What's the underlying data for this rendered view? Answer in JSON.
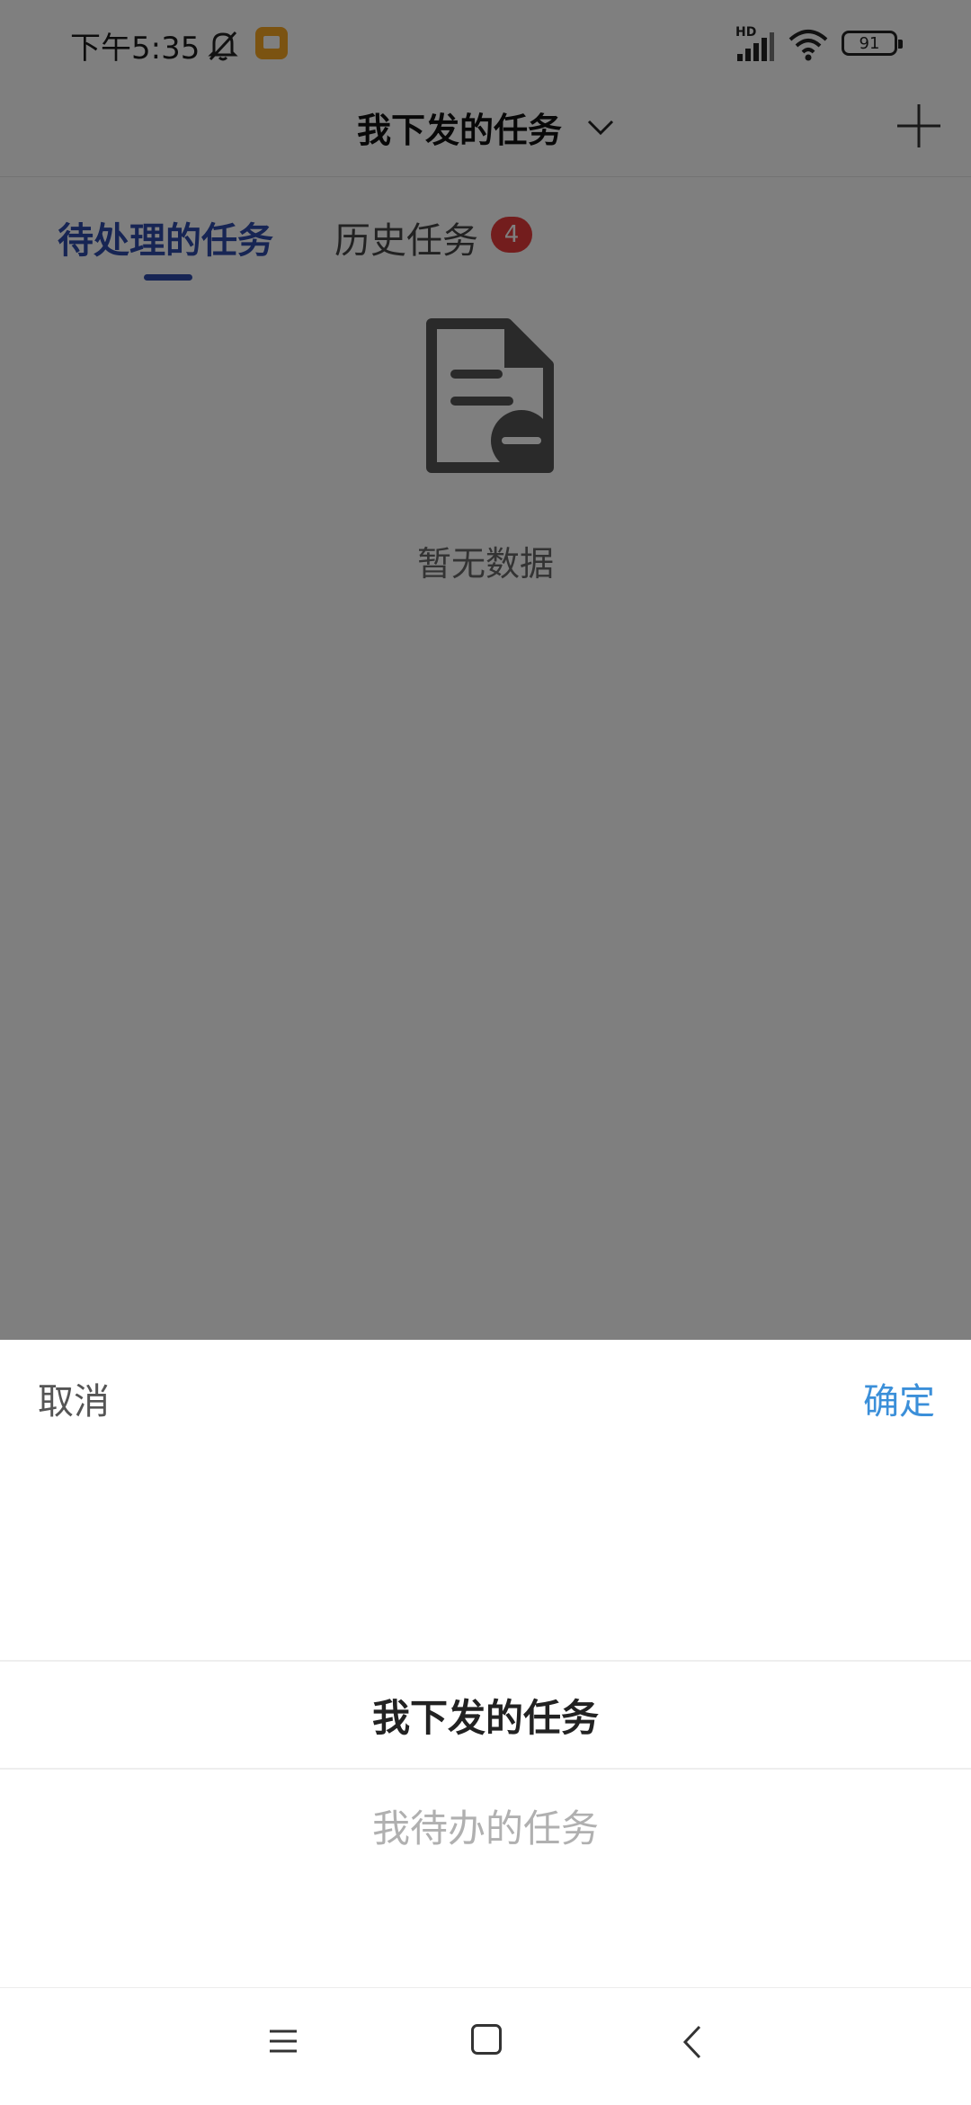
{
  "status_bar": {
    "time": "下午5:35",
    "hd_label": "HD",
    "battery": "91",
    "icons": [
      "mute-icon",
      "app-notification-icon",
      "signal-icon",
      "wifi-icon",
      "battery-icon"
    ]
  },
  "header": {
    "title": "我下发的任务",
    "icons": [
      "chevron-down-icon",
      "add-icon"
    ]
  },
  "tabs": [
    {
      "label": "待处理的任务",
      "active": true
    },
    {
      "label": "历史任务",
      "badge": "4"
    }
  ],
  "empty_state": {
    "text": "暂无数据",
    "icon": "document-remove-icon"
  },
  "sheet": {
    "cancel_label": "取消",
    "confirm_label": "确定",
    "options": [
      "我下发的任务",
      "我待办的任务"
    ],
    "selected": "我下发的任务"
  },
  "nav_bar": {
    "icons": [
      "menu-icon",
      "home-icon",
      "back-icon"
    ]
  },
  "colors": {
    "accent": "#2f4aa8",
    "confirm": "#3b8fd9",
    "badge": "#e63a3a",
    "overlay": "rgba(0,0,0,0.5)"
  }
}
